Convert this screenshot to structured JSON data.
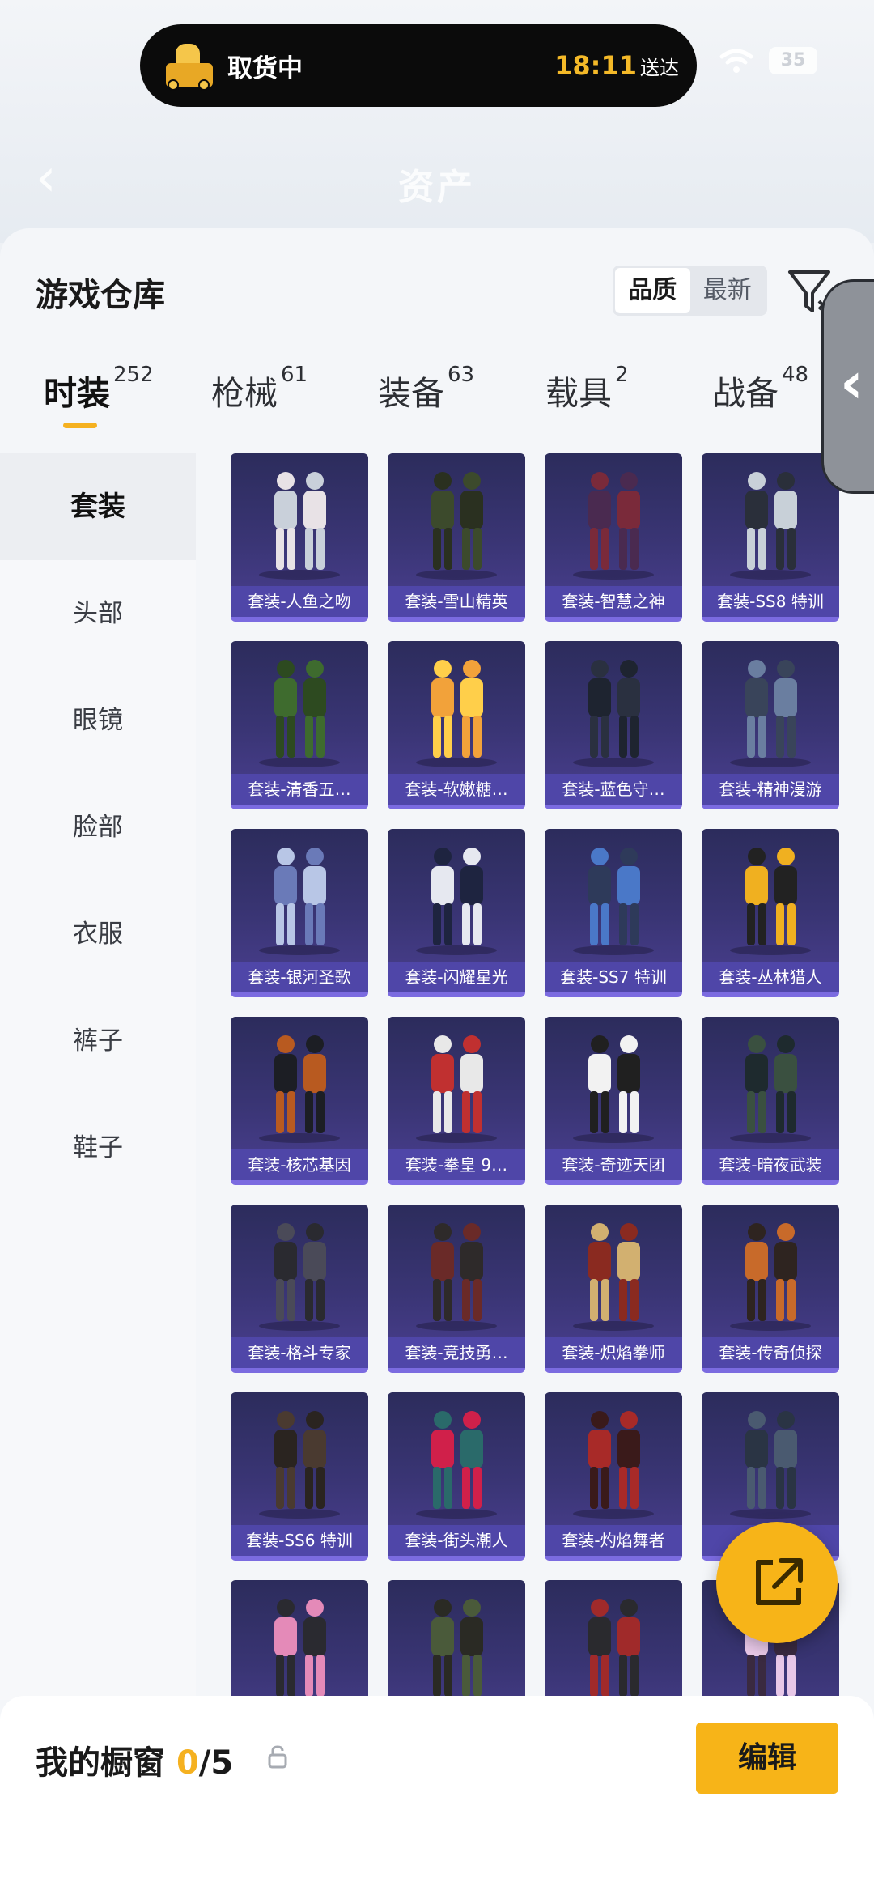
{
  "status_pill": {
    "label": "取货中",
    "time": "18:11",
    "suffix": "送达"
  },
  "status_bar": {
    "battery": "35"
  },
  "header": {
    "title": "资产"
  },
  "warehouse": {
    "title": "游戏仓库",
    "sort": [
      "品质",
      "最新"
    ],
    "active_sort": "品质"
  },
  "tabs": [
    {
      "label": "时装",
      "count": "252"
    },
    {
      "label": "枪械",
      "count": "61"
    },
    {
      "label": "装备",
      "count": "63"
    },
    {
      "label": "载具",
      "count": "2"
    },
    {
      "label": "战备",
      "count": "48"
    }
  ],
  "sidebar": [
    "套装",
    "头部",
    "眼镜",
    "脸部",
    "衣服",
    "裤子",
    "鞋子"
  ],
  "items": [
    "套装-人鱼之吻",
    "套装-雪山精英",
    "套装-智慧之神",
    "套装-SS8 特训",
    "套装-清香五…",
    "套装-软嫩糖…",
    "套装-蓝色守…",
    "套装-精神漫游",
    "套装-银河圣歌",
    "套装-闪耀星光",
    "套装-SS7 特训",
    "套装-丛林猎人",
    "套装-核芯基因",
    "套装-拳皇 9…",
    "套装-奇迹天团",
    "套装-暗夜武装",
    "套装-格斗专家",
    "套装-竞技勇…",
    "套装-炽焰拳师",
    "套装-传奇侦探",
    "套装-SS6 特训",
    "套装-街头潮人",
    "套装-灼焰舞者",
    "套装-",
    "",
    "",
    "",
    ""
  ],
  "showcase": {
    "title": "我的橱窗",
    "current": "0",
    "max": "/5"
  },
  "edit_label": "编辑",
  "colors": {
    "accent": "#f7b418",
    "card_bg": "#3a3575",
    "caption_bg": "#4f46a8"
  }
}
